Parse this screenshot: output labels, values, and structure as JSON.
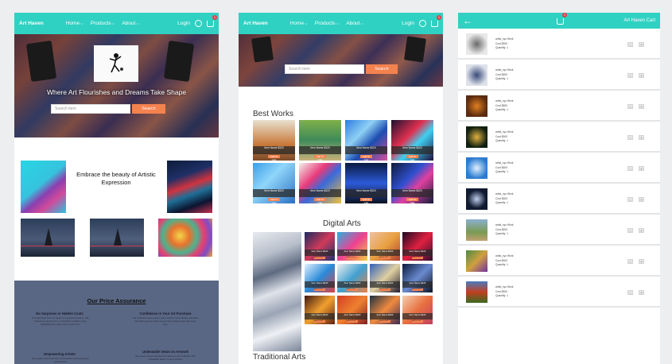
{
  "brand": "Art Haven",
  "nav": {
    "menu": [
      "Home",
      "Products",
      "About"
    ],
    "login": "Login",
    "cart_count": "1"
  },
  "home": {
    "hero_title": "Where Art Flourishes and Dreams Take Shape",
    "search_placeholder": "Search item",
    "search_button": "Search",
    "feature_title": "Embrace the beauty of Artistic Expression",
    "assurance": {
      "title": "Our Price Assurance",
      "items": [
        {
          "title": "No Surprises or Hidden Costs",
          "text": "Purchasing art from Art Haven is a genuine pleasure, with transparent pricing from no surprises to hidden costs, highlighting the value of art in each item."
        },
        {
          "title": "Confidence in Your Art Purchase",
          "text": "Our dedicated team ensures each artwork meets quality standards and offers genuine value so your art purchase feels right every time."
        },
        {
          "title": "Empowering Artists",
          "text": "We support artists with fair compensation and transparent partnerships."
        },
        {
          "title": "Unbeatable Deals on Artwork",
          "text": "We ensure that you get the best value for your collection with unbeatable deals on every artwork."
        }
      ]
    }
  },
  "shop": {
    "search_placeholder": "Search item",
    "search_button": "Search",
    "best_works_title": "Best Works",
    "digital_arts_title": "Digital Arts",
    "traditional_arts_title": "Traditional Arts",
    "card_name": "Item Name",
    "card_price": "$320",
    "card_button": "Add To Cart"
  },
  "cart": {
    "title": "Art Haven Cart",
    "count": "1",
    "item_name": "artist_xyz Work",
    "item_price": "Cost $300",
    "item_qty": "Quantity: 1",
    "minus": "-",
    "plus": "+"
  }
}
